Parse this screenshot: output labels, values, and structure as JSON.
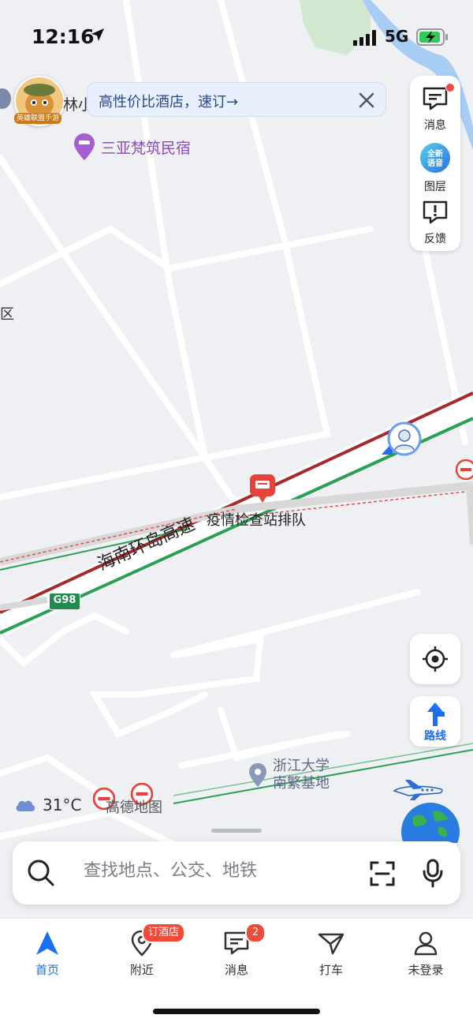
{
  "status_bar": {
    "time": "12:16",
    "network": "5G"
  },
  "banner": {
    "text": "高性价比酒店，速订→"
  },
  "game_badge": {
    "label": "英雄联盟手游"
  },
  "map": {
    "labels": {
      "lin": "林小",
      "district": "区",
      "hotel_poi": "三亚梵筑民宿",
      "checkpoint": "疫情检查站排队",
      "highway": "海南环岛高速",
      "highway_code": "G98",
      "zju_line1": "浙江大学",
      "zju_line2": "南繁基地"
    }
  },
  "side_panel": {
    "messages_label": "消息",
    "layers_label": "图层",
    "layers_icon_text": "全新语音",
    "feedback_label": "反馈"
  },
  "route_button": {
    "label": "路线"
  },
  "weather": {
    "temperature": "31°C"
  },
  "brand": {
    "name": "高德地图"
  },
  "search": {
    "placeholder": "查找地点、公交、地铁"
  },
  "tabbar": {
    "tabs": [
      {
        "label": "首页",
        "active": true
      },
      {
        "label": "附近",
        "badge": "订酒店"
      },
      {
        "label": "消息",
        "badge": "2"
      },
      {
        "label": "打车"
      },
      {
        "label": "未登录"
      }
    ]
  },
  "colors": {
    "accent": "#1a6ff0",
    "badge": "#f04a3a",
    "hotel": "#8b4cb8",
    "highway_green": "#2aa052",
    "highway_red": "#a52a2a"
  }
}
